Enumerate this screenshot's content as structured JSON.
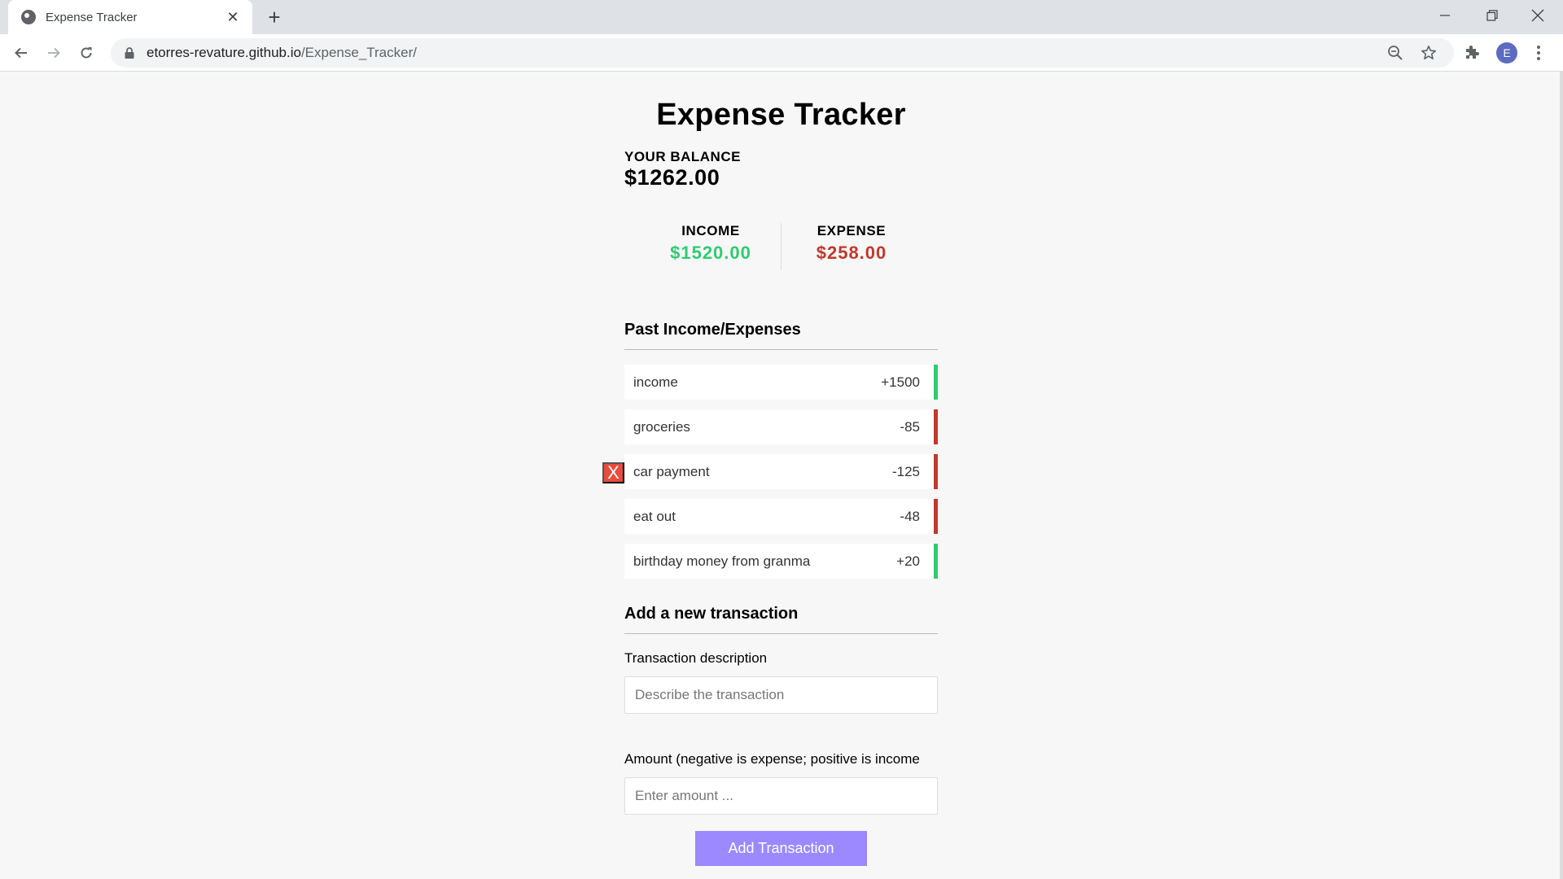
{
  "browser": {
    "tab_title": "Expense Tracker",
    "url_host": "etorres-revature.github.io",
    "url_path": "/Expense_Tracker/",
    "profile_initial": "E"
  },
  "page": {
    "title": "Expense Tracker",
    "balance_label": "YOUR BALANCE",
    "balance_value": "$1262.00",
    "income_label": "INCOME",
    "income_value": "$1520.00",
    "expense_label": "EXPENSE",
    "expense_value": "$258.00",
    "history_heading": "Past Income/Expenses",
    "transactions": [
      {
        "text": "income",
        "amount": "+1500",
        "type": "plus"
      },
      {
        "text": "groceries",
        "amount": "-85",
        "type": "minus"
      },
      {
        "text": "car payment",
        "amount": "-125",
        "type": "minus",
        "hovered": true
      },
      {
        "text": "eat out",
        "amount": "-48",
        "type": "minus"
      },
      {
        "text": "birthday money from granma",
        "amount": "+20",
        "type": "plus"
      }
    ],
    "delete_label": "X",
    "form_heading": "Add a new transaction",
    "desc_label": "Transaction description",
    "desc_placeholder": "Describe the transaction",
    "desc_value": "",
    "amount_label": "Amount (negative is expense; positive is income",
    "amount_placeholder": "Enter amount ...",
    "amount_value": "",
    "submit_label": "Add Transaction"
  },
  "colors": {
    "income": "#2ecc71",
    "expense": "#c0392b",
    "delete": "#e74c3c",
    "button": "#9c88ff"
  }
}
